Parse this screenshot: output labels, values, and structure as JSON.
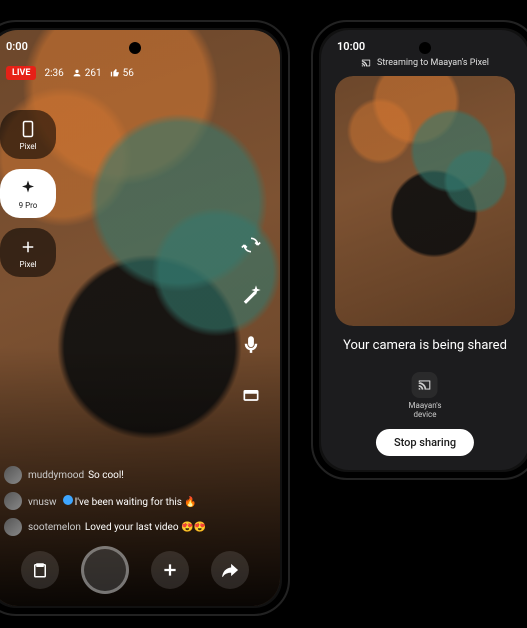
{
  "left": {
    "status_time": "0:00",
    "live_label": "LIVE",
    "duration": "2:36",
    "viewers": "261",
    "likes": "56",
    "rail": {
      "pixel": "Pixel",
      "pro": "9 Pro",
      "add": "Pixel"
    },
    "comments": [
      {
        "user": "muddymood",
        "text": "So cool!"
      },
      {
        "user": "vnusw",
        "text": "I've been waiting for this 🔥"
      },
      {
        "user": "sootemelon",
        "text": "Loved your last video 😍😍"
      }
    ]
  },
  "right": {
    "status_time": "10:00",
    "stream_label": "Streaming to Maayan's Pixel",
    "share_title": "Your camera is being shared",
    "device_label": "Maayan's\ndevice",
    "stop_label": "Stop sharing"
  }
}
